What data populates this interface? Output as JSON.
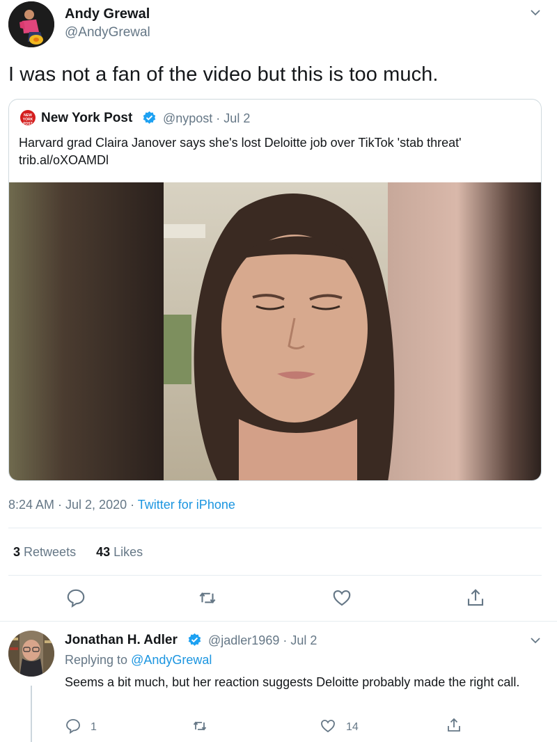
{
  "tweet": {
    "author_name": "Andy Grewal",
    "author_handle": "@AndyGrewal",
    "text": "I was not a fan of the video but this is too much.",
    "quote": {
      "logo_text": "NEW YORK POST",
      "author_name": "New York Post",
      "author_handle": "@nypost · Jul 2",
      "text_line1": "Harvard grad Claira Janover says she's lost Deloitte job over TikTok 'stab threat'",
      "text_line2": "trib.al/oXOAMDl"
    },
    "timestamp": "8:24 AM · Jul 2, 2020 ·",
    "source": "Twitter for iPhone",
    "retweets_count": "3",
    "retweets_label": "Retweets",
    "likes_count": "43",
    "likes_label": "Likes"
  },
  "reply": {
    "author_name": "Jonathan H. Adler",
    "author_handle": "@jadler1969 · Jul 2",
    "replying_prefix": "Replying to",
    "replying_handle": "@AndyGrewal",
    "text": "Seems a bit much, but her reaction suggests Deloitte probably made the right call.",
    "reply_count": "1",
    "like_count": "14"
  },
  "icons": [
    "chevron-down-icon",
    "verified-badge-icon",
    "reply-icon",
    "retweet-icon",
    "like-icon",
    "share-icon"
  ],
  "colors": {
    "link": "#1b95e0",
    "muted": "#657786",
    "verified": "#1da1f2",
    "divider": "#e6ecf0",
    "border": "#cfd9de"
  }
}
